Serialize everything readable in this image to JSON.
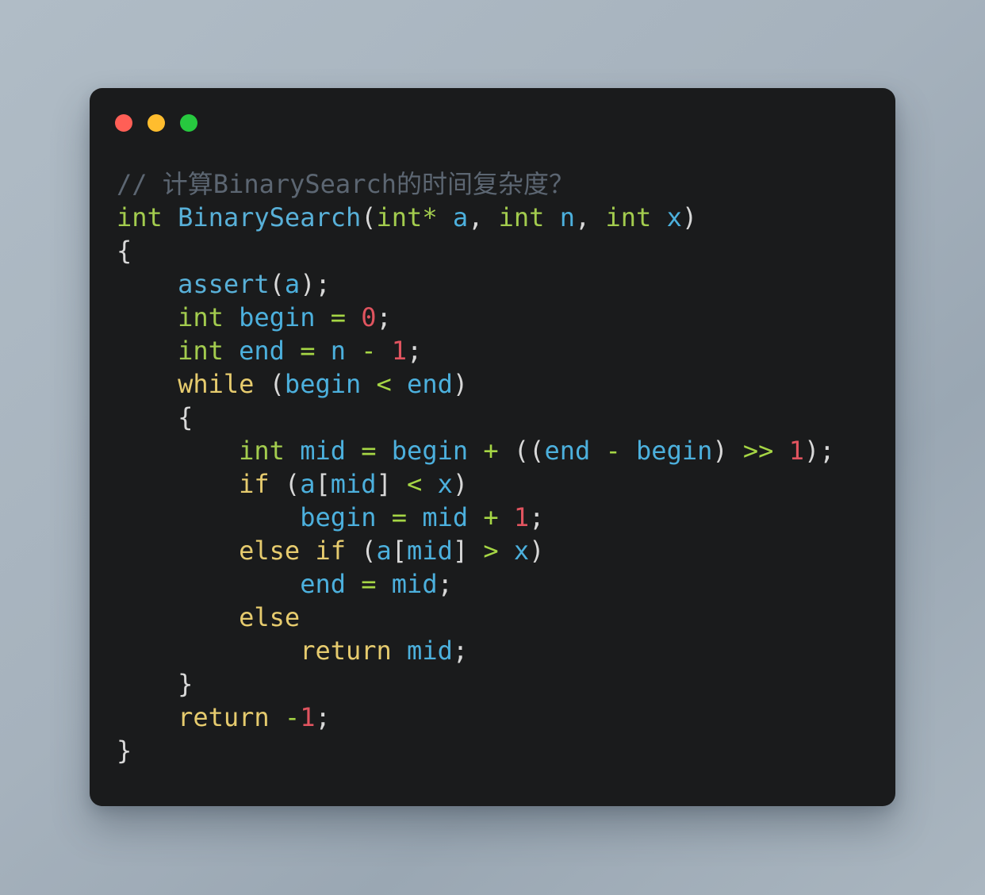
{
  "window": {
    "traffic_lights": [
      {
        "name": "close",
        "color": "#ff5f56"
      },
      {
        "name": "minimize",
        "color": "#ffbd2e"
      },
      {
        "name": "maximize",
        "color": "#27c93f"
      }
    ],
    "background_color": "#1a1b1c",
    "page_background_color": "#a6b2bd"
  },
  "theme": {
    "comment": "#5c6672",
    "type": "#a3cc4e",
    "function": "#58b0d8",
    "identifier": "#4cb0dd",
    "keyword": "#e6cb6e",
    "operator": "#a6d645",
    "number": "#e0545f",
    "punctuation": "#d8d8d8"
  },
  "code": {
    "language": "cpp",
    "plain_text": "// 计算BinarySearch的时间复杂度？\nint BinarySearch(int* a, int n, int x)\n{\n    assert(a);\n    int begin = 0;\n    int end = n - 1;\n    while (begin < end)\n    {\n        int mid = begin + ((end - begin) >> 1);\n        if (a[mid] < x)\n            begin = mid + 1;\n        else if (a[mid] > x)\n            end = mid;\n        else\n            return mid;\n    }\n    return -1;\n}",
    "lines": [
      [
        {
          "t": "comment",
          "s": "// 计算BinarySearch的时间复杂度？"
        }
      ],
      [
        {
          "t": "type",
          "s": "int"
        },
        {
          "t": "plain",
          "s": " "
        },
        {
          "t": "func",
          "s": "BinarySearch"
        },
        {
          "t": "punct",
          "s": "("
        },
        {
          "t": "type",
          "s": "int*"
        },
        {
          "t": "plain",
          "s": " "
        },
        {
          "t": "ident",
          "s": "a"
        },
        {
          "t": "punct",
          "s": ","
        },
        {
          "t": "plain",
          "s": " "
        },
        {
          "t": "type",
          "s": "int"
        },
        {
          "t": "plain",
          "s": " "
        },
        {
          "t": "ident",
          "s": "n"
        },
        {
          "t": "punct",
          "s": ","
        },
        {
          "t": "plain",
          "s": " "
        },
        {
          "t": "type",
          "s": "int"
        },
        {
          "t": "plain",
          "s": " "
        },
        {
          "t": "ident",
          "s": "x"
        },
        {
          "t": "punct",
          "s": ")"
        }
      ],
      [
        {
          "t": "punct",
          "s": "{"
        }
      ],
      [
        {
          "t": "plain",
          "s": "    "
        },
        {
          "t": "func",
          "s": "assert"
        },
        {
          "t": "punct",
          "s": "("
        },
        {
          "t": "ident",
          "s": "a"
        },
        {
          "t": "punct",
          "s": ");"
        }
      ],
      [
        {
          "t": "plain",
          "s": "    "
        },
        {
          "t": "type",
          "s": "int"
        },
        {
          "t": "plain",
          "s": " "
        },
        {
          "t": "ident",
          "s": "begin"
        },
        {
          "t": "plain",
          "s": " "
        },
        {
          "t": "op",
          "s": "="
        },
        {
          "t": "plain",
          "s": " "
        },
        {
          "t": "num",
          "s": "0"
        },
        {
          "t": "punct",
          "s": ";"
        }
      ],
      [
        {
          "t": "plain",
          "s": "    "
        },
        {
          "t": "type",
          "s": "int"
        },
        {
          "t": "plain",
          "s": " "
        },
        {
          "t": "ident",
          "s": "end"
        },
        {
          "t": "plain",
          "s": " "
        },
        {
          "t": "op",
          "s": "="
        },
        {
          "t": "plain",
          "s": " "
        },
        {
          "t": "ident",
          "s": "n"
        },
        {
          "t": "plain",
          "s": " "
        },
        {
          "t": "op",
          "s": "-"
        },
        {
          "t": "plain",
          "s": " "
        },
        {
          "t": "num",
          "s": "1"
        },
        {
          "t": "punct",
          "s": ";"
        }
      ],
      [
        {
          "t": "plain",
          "s": "    "
        },
        {
          "t": "keyword",
          "s": "while"
        },
        {
          "t": "plain",
          "s": " "
        },
        {
          "t": "punct",
          "s": "("
        },
        {
          "t": "ident",
          "s": "begin"
        },
        {
          "t": "plain",
          "s": " "
        },
        {
          "t": "op",
          "s": "<"
        },
        {
          "t": "plain",
          "s": " "
        },
        {
          "t": "ident",
          "s": "end"
        },
        {
          "t": "punct",
          "s": ")"
        }
      ],
      [
        {
          "t": "plain",
          "s": "    "
        },
        {
          "t": "punct",
          "s": "{"
        }
      ],
      [
        {
          "t": "plain",
          "s": "        "
        },
        {
          "t": "type",
          "s": "int"
        },
        {
          "t": "plain",
          "s": " "
        },
        {
          "t": "ident",
          "s": "mid"
        },
        {
          "t": "plain",
          "s": " "
        },
        {
          "t": "op",
          "s": "="
        },
        {
          "t": "plain",
          "s": " "
        },
        {
          "t": "ident",
          "s": "begin"
        },
        {
          "t": "plain",
          "s": " "
        },
        {
          "t": "op",
          "s": "+"
        },
        {
          "t": "plain",
          "s": " "
        },
        {
          "t": "punct",
          "s": "(("
        },
        {
          "t": "ident",
          "s": "end"
        },
        {
          "t": "plain",
          "s": " "
        },
        {
          "t": "op",
          "s": "-"
        },
        {
          "t": "plain",
          "s": " "
        },
        {
          "t": "ident",
          "s": "begin"
        },
        {
          "t": "punct",
          "s": ")"
        },
        {
          "t": "plain",
          "s": " "
        },
        {
          "t": "op",
          "s": ">>"
        },
        {
          "t": "plain",
          "s": " "
        },
        {
          "t": "num",
          "s": "1"
        },
        {
          "t": "punct",
          "s": ");"
        }
      ],
      [
        {
          "t": "plain",
          "s": "        "
        },
        {
          "t": "keyword",
          "s": "if"
        },
        {
          "t": "plain",
          "s": " "
        },
        {
          "t": "punct",
          "s": "("
        },
        {
          "t": "ident",
          "s": "a"
        },
        {
          "t": "punct",
          "s": "["
        },
        {
          "t": "ident",
          "s": "mid"
        },
        {
          "t": "punct",
          "s": "]"
        },
        {
          "t": "plain",
          "s": " "
        },
        {
          "t": "op",
          "s": "<"
        },
        {
          "t": "plain",
          "s": " "
        },
        {
          "t": "ident",
          "s": "x"
        },
        {
          "t": "punct",
          "s": ")"
        }
      ],
      [
        {
          "t": "plain",
          "s": "            "
        },
        {
          "t": "ident",
          "s": "begin"
        },
        {
          "t": "plain",
          "s": " "
        },
        {
          "t": "op",
          "s": "="
        },
        {
          "t": "plain",
          "s": " "
        },
        {
          "t": "ident",
          "s": "mid"
        },
        {
          "t": "plain",
          "s": " "
        },
        {
          "t": "op",
          "s": "+"
        },
        {
          "t": "plain",
          "s": " "
        },
        {
          "t": "num",
          "s": "1"
        },
        {
          "t": "punct",
          "s": ";"
        }
      ],
      [
        {
          "t": "plain",
          "s": "        "
        },
        {
          "t": "keyword",
          "s": "else if"
        },
        {
          "t": "plain",
          "s": " "
        },
        {
          "t": "punct",
          "s": "("
        },
        {
          "t": "ident",
          "s": "a"
        },
        {
          "t": "punct",
          "s": "["
        },
        {
          "t": "ident",
          "s": "mid"
        },
        {
          "t": "punct",
          "s": "]"
        },
        {
          "t": "plain",
          "s": " "
        },
        {
          "t": "op",
          "s": ">"
        },
        {
          "t": "plain",
          "s": " "
        },
        {
          "t": "ident",
          "s": "x"
        },
        {
          "t": "punct",
          "s": ")"
        }
      ],
      [
        {
          "t": "plain",
          "s": "            "
        },
        {
          "t": "ident",
          "s": "end"
        },
        {
          "t": "plain",
          "s": " "
        },
        {
          "t": "op",
          "s": "="
        },
        {
          "t": "plain",
          "s": " "
        },
        {
          "t": "ident",
          "s": "mid"
        },
        {
          "t": "punct",
          "s": ";"
        }
      ],
      [
        {
          "t": "plain",
          "s": "        "
        },
        {
          "t": "keyword",
          "s": "else"
        }
      ],
      [
        {
          "t": "plain",
          "s": "            "
        },
        {
          "t": "keyword",
          "s": "return"
        },
        {
          "t": "plain",
          "s": " "
        },
        {
          "t": "ident",
          "s": "mid"
        },
        {
          "t": "punct",
          "s": ";"
        }
      ],
      [
        {
          "t": "plain",
          "s": "    "
        },
        {
          "t": "punct",
          "s": "}"
        }
      ],
      [
        {
          "t": "plain",
          "s": "    "
        },
        {
          "t": "keyword",
          "s": "return"
        },
        {
          "t": "plain",
          "s": " "
        },
        {
          "t": "op",
          "s": "-"
        },
        {
          "t": "num",
          "s": "1"
        },
        {
          "t": "punct",
          "s": ";"
        }
      ],
      [
        {
          "t": "punct",
          "s": "}"
        }
      ]
    ]
  }
}
